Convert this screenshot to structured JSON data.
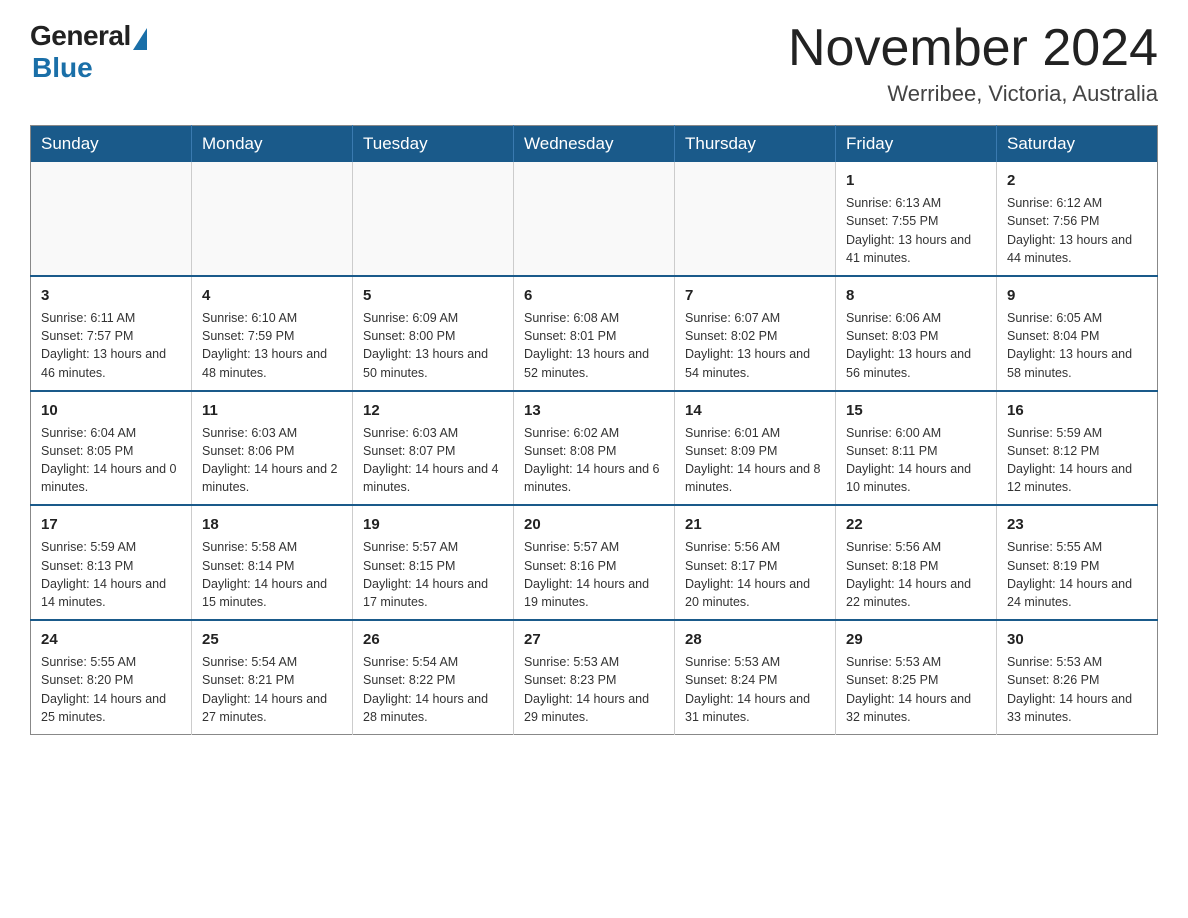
{
  "logo": {
    "general": "General",
    "blue": "Blue"
  },
  "title": {
    "month_year": "November 2024",
    "location": "Werribee, Victoria, Australia"
  },
  "headers": [
    "Sunday",
    "Monday",
    "Tuesday",
    "Wednesday",
    "Thursday",
    "Friday",
    "Saturday"
  ],
  "weeks": [
    [
      {
        "day": "",
        "info": ""
      },
      {
        "day": "",
        "info": ""
      },
      {
        "day": "",
        "info": ""
      },
      {
        "day": "",
        "info": ""
      },
      {
        "day": "",
        "info": ""
      },
      {
        "day": "1",
        "info": "Sunrise: 6:13 AM\nSunset: 7:55 PM\nDaylight: 13 hours and 41 minutes."
      },
      {
        "day": "2",
        "info": "Sunrise: 6:12 AM\nSunset: 7:56 PM\nDaylight: 13 hours and 44 minutes."
      }
    ],
    [
      {
        "day": "3",
        "info": "Sunrise: 6:11 AM\nSunset: 7:57 PM\nDaylight: 13 hours and 46 minutes."
      },
      {
        "day": "4",
        "info": "Sunrise: 6:10 AM\nSunset: 7:59 PM\nDaylight: 13 hours and 48 minutes."
      },
      {
        "day": "5",
        "info": "Sunrise: 6:09 AM\nSunset: 8:00 PM\nDaylight: 13 hours and 50 minutes."
      },
      {
        "day": "6",
        "info": "Sunrise: 6:08 AM\nSunset: 8:01 PM\nDaylight: 13 hours and 52 minutes."
      },
      {
        "day": "7",
        "info": "Sunrise: 6:07 AM\nSunset: 8:02 PM\nDaylight: 13 hours and 54 minutes."
      },
      {
        "day": "8",
        "info": "Sunrise: 6:06 AM\nSunset: 8:03 PM\nDaylight: 13 hours and 56 minutes."
      },
      {
        "day": "9",
        "info": "Sunrise: 6:05 AM\nSunset: 8:04 PM\nDaylight: 13 hours and 58 minutes."
      }
    ],
    [
      {
        "day": "10",
        "info": "Sunrise: 6:04 AM\nSunset: 8:05 PM\nDaylight: 14 hours and 0 minutes."
      },
      {
        "day": "11",
        "info": "Sunrise: 6:03 AM\nSunset: 8:06 PM\nDaylight: 14 hours and 2 minutes."
      },
      {
        "day": "12",
        "info": "Sunrise: 6:03 AM\nSunset: 8:07 PM\nDaylight: 14 hours and 4 minutes."
      },
      {
        "day": "13",
        "info": "Sunrise: 6:02 AM\nSunset: 8:08 PM\nDaylight: 14 hours and 6 minutes."
      },
      {
        "day": "14",
        "info": "Sunrise: 6:01 AM\nSunset: 8:09 PM\nDaylight: 14 hours and 8 minutes."
      },
      {
        "day": "15",
        "info": "Sunrise: 6:00 AM\nSunset: 8:11 PM\nDaylight: 14 hours and 10 minutes."
      },
      {
        "day": "16",
        "info": "Sunrise: 5:59 AM\nSunset: 8:12 PM\nDaylight: 14 hours and 12 minutes."
      }
    ],
    [
      {
        "day": "17",
        "info": "Sunrise: 5:59 AM\nSunset: 8:13 PM\nDaylight: 14 hours and 14 minutes."
      },
      {
        "day": "18",
        "info": "Sunrise: 5:58 AM\nSunset: 8:14 PM\nDaylight: 14 hours and 15 minutes."
      },
      {
        "day": "19",
        "info": "Sunrise: 5:57 AM\nSunset: 8:15 PM\nDaylight: 14 hours and 17 minutes."
      },
      {
        "day": "20",
        "info": "Sunrise: 5:57 AM\nSunset: 8:16 PM\nDaylight: 14 hours and 19 minutes."
      },
      {
        "day": "21",
        "info": "Sunrise: 5:56 AM\nSunset: 8:17 PM\nDaylight: 14 hours and 20 minutes."
      },
      {
        "day": "22",
        "info": "Sunrise: 5:56 AM\nSunset: 8:18 PM\nDaylight: 14 hours and 22 minutes."
      },
      {
        "day": "23",
        "info": "Sunrise: 5:55 AM\nSunset: 8:19 PM\nDaylight: 14 hours and 24 minutes."
      }
    ],
    [
      {
        "day": "24",
        "info": "Sunrise: 5:55 AM\nSunset: 8:20 PM\nDaylight: 14 hours and 25 minutes."
      },
      {
        "day": "25",
        "info": "Sunrise: 5:54 AM\nSunset: 8:21 PM\nDaylight: 14 hours and 27 minutes."
      },
      {
        "day": "26",
        "info": "Sunrise: 5:54 AM\nSunset: 8:22 PM\nDaylight: 14 hours and 28 minutes."
      },
      {
        "day": "27",
        "info": "Sunrise: 5:53 AM\nSunset: 8:23 PM\nDaylight: 14 hours and 29 minutes."
      },
      {
        "day": "28",
        "info": "Sunrise: 5:53 AM\nSunset: 8:24 PM\nDaylight: 14 hours and 31 minutes."
      },
      {
        "day": "29",
        "info": "Sunrise: 5:53 AM\nSunset: 8:25 PM\nDaylight: 14 hours and 32 minutes."
      },
      {
        "day": "30",
        "info": "Sunrise: 5:53 AM\nSunset: 8:26 PM\nDaylight: 14 hours and 33 minutes."
      }
    ]
  ]
}
